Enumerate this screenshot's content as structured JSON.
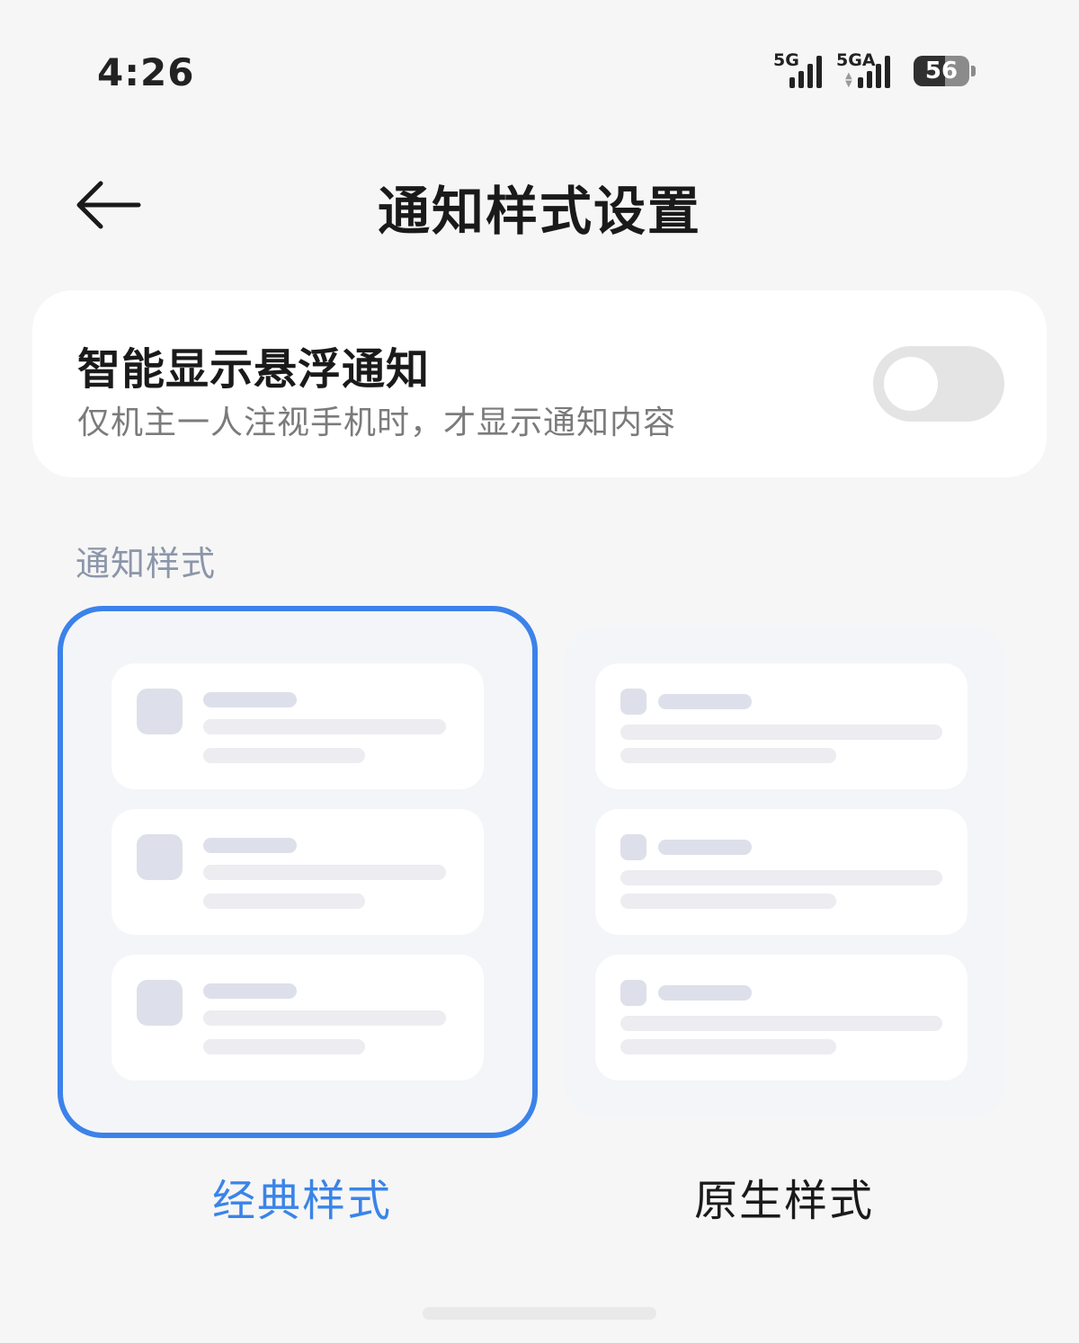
{
  "status_bar": {
    "time": "4:26",
    "network1": "5G",
    "network2": "5GA",
    "battery": "56"
  },
  "header": {
    "title": "通知样式设置"
  },
  "smart_card": {
    "title": "智能显示悬浮通知",
    "subtitle": "仅机主一人注视手机时，才显示通知内容",
    "toggle_on": false
  },
  "section": {
    "label": "通知样式"
  },
  "options": [
    {
      "label": "经典样式",
      "selected": true
    },
    {
      "label": "原生样式",
      "selected": false
    }
  ],
  "colors": {
    "accent": "#3b82ea",
    "background": "#f6f6f6"
  }
}
